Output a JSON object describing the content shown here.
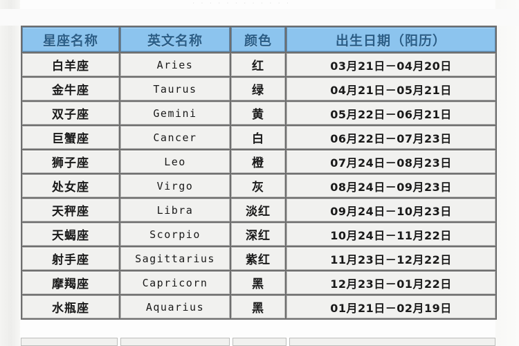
{
  "page": {
    "top_remnant": "· · · · ·    · ·     · · · · ·",
    "header_bg": "#8cc4ee",
    "header_text_color": "#2a5d86",
    "row_bg": "#f1f1ef",
    "grid_color": "#6e6e6e"
  },
  "table": {
    "columns": [
      {
        "key": "cn_name",
        "label": "星座名称"
      },
      {
        "key": "en_name",
        "label": "英文名称"
      },
      {
        "key": "color",
        "label": "颜色"
      },
      {
        "key": "date",
        "label": "出生日期（阳历）"
      }
    ],
    "rows": [
      {
        "cn_name": "白羊座",
        "en_name": "Aries",
        "color": "红",
        "date": "03月21日－04月20日"
      },
      {
        "cn_name": "金牛座",
        "en_name": "Taurus",
        "color": "绿",
        "date": "04月21日－05月21日"
      },
      {
        "cn_name": "双子座",
        "en_name": "Gemini",
        "color": "黄",
        "date": "05月22日－06月21日"
      },
      {
        "cn_name": "巨蟹座",
        "en_name": "Cancer",
        "color": "白",
        "date": "06月22日－07月23日"
      },
      {
        "cn_name": "狮子座",
        "en_name": "Leo",
        "color": "橙",
        "date": "07月24日－08月23日"
      },
      {
        "cn_name": "处女座",
        "en_name": "Virgo",
        "color": "灰",
        "date": "08月24日－09月23日"
      },
      {
        "cn_name": "天秤座",
        "en_name": "Libra",
        "color": "淡红",
        "date": "09月24日－10月23日"
      },
      {
        "cn_name": "天蝎座",
        "en_name": "Scorpio",
        "color": "深红",
        "date": "10月24日－11月22日"
      },
      {
        "cn_name": "射手座",
        "en_name": "Sagittarius",
        "color": "紫红",
        "date": "11月23日－12月22日"
      },
      {
        "cn_name": "摩羯座",
        "en_name": "Capricorn",
        "color": "黑",
        "date": "12月23日－01月22日"
      },
      {
        "cn_name": "水瓶座",
        "en_name": "Aquarius",
        "color": "黑",
        "date": "01月21日－02月19日"
      }
    ]
  }
}
